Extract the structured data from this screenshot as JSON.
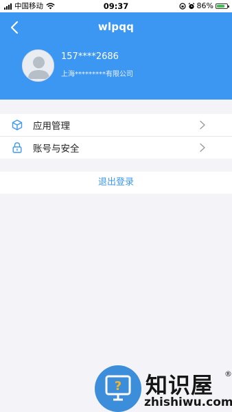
{
  "status_bar": {
    "carrier": "中国移动",
    "time": "09:37",
    "battery": "86%",
    "battery_level": 0.86
  },
  "header": {
    "title": "wlpqq",
    "back_icon": "chevron-left-icon",
    "background_color": "#3c97f3"
  },
  "profile": {
    "phone": "157****2686",
    "company": "上海*********有限公司"
  },
  "menu": {
    "items": [
      {
        "label": "应用管理",
        "icon": "cube-icon"
      },
      {
        "label": "账号与安全",
        "icon": "lock-icon"
      }
    ]
  },
  "logout": {
    "label": "退出登录",
    "color": "#3c97f3"
  },
  "watermark": {
    "brand_cn": "知识屋",
    "brand_en": "zhishiwu.com",
    "mark": "®"
  }
}
